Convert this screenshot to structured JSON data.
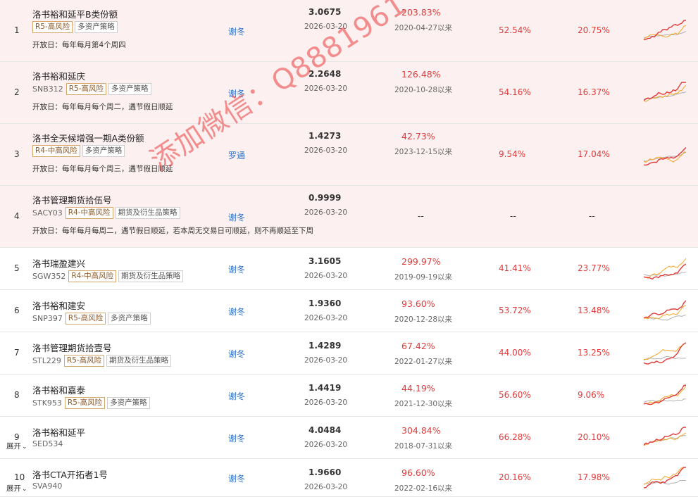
{
  "funds": [
    {
      "rank": "1",
      "name": "洛书裕和延平B类份额",
      "code": "",
      "tags": [
        "R5-高风险",
        "多资产策略"
      ],
      "open": "开放日：每年每月第4个周四",
      "manager": "谢冬",
      "nav": "3.0675",
      "nav_date": "2026-03-20",
      "total_return": "203.83%",
      "since": "2020-04-27以来",
      "ret_a": "52.54%",
      "ret_b": "20.75%"
    },
    {
      "rank": "2",
      "name": "洛书裕和延庆",
      "code": "SNB312",
      "tags": [
        "R5-高风险",
        "多资产策略"
      ],
      "open": "开放日：每年每月每个周二，遇节假日顺延",
      "manager": "谢冬",
      "nav": "2.2648",
      "nav_date": "2026-03-20",
      "total_return": "126.48%",
      "since": "2020-10-28以来",
      "ret_a": "54.16%",
      "ret_b": "16.37%"
    },
    {
      "rank": "3",
      "name": "洛书全天候增强一期A类份额",
      "code": "",
      "tags": [
        "R4-中高风险",
        "多资产策略"
      ],
      "open": "开放日：每年每月每个周三，遇节假日顺延",
      "manager": "罗通",
      "nav": "1.4273",
      "nav_date": "2026-03-20",
      "total_return": "42.73%",
      "since": "2023-12-15以来",
      "ret_a": "9.54%",
      "ret_b": "17.04%"
    },
    {
      "rank": "4",
      "name": "洛书管理期货拾伍号",
      "code": "SACY03",
      "tags": [
        "R4-中高风险",
        "期货及衍生品策略"
      ],
      "open": "开放日：每年每月每周二，遇节假日顺延，若本周无交易日可顺延，则不再顺延至下周",
      "manager": "谢冬",
      "nav": "0.9999",
      "nav_date": "2026-03-20",
      "total_return": "--",
      "since": "",
      "ret_a": "--",
      "ret_b": "--"
    },
    {
      "rank": "5",
      "name": "洛书瑞盈建兴",
      "code": "SGW352",
      "tags": [
        "R4-中高风险",
        "期货及衍生品策略"
      ],
      "open": "",
      "manager": "谢冬",
      "nav": "3.1605",
      "nav_date": "2026-03-20",
      "total_return": "299.97%",
      "since": "2019-09-19以来",
      "ret_a": "41.41%",
      "ret_b": "23.77%"
    },
    {
      "rank": "6",
      "name": "洛书裕和建安",
      "code": "SNP397",
      "tags": [
        "R5-高风险",
        "多资产策略"
      ],
      "open": "",
      "manager": "谢冬",
      "nav": "1.9360",
      "nav_date": "2026-03-20",
      "total_return": "93.60%",
      "since": "2020-12-28以来",
      "ret_a": "53.72%",
      "ret_b": "13.48%"
    },
    {
      "rank": "7",
      "name": "洛书管理期货拾壹号",
      "code": "STL229",
      "tags": [
        "R5-高风险",
        "期货及衍生品策略"
      ],
      "open": "",
      "manager": "谢冬",
      "nav": "1.4289",
      "nav_date": "2026-03-20",
      "total_return": "67.42%",
      "since": "2022-01-27以来",
      "ret_a": "44.00%",
      "ret_b": "13.25%"
    },
    {
      "rank": "8",
      "name": "洛书裕和嘉泰",
      "code": "STK953",
      "tags": [
        "R5-高风险",
        "多资产策略"
      ],
      "open": "",
      "manager": "谢冬",
      "nav": "1.4419",
      "nav_date": "2026-03-20",
      "total_return": "44.19%",
      "since": "2021-12-30以来",
      "ret_a": "56.60%",
      "ret_b": "9.06%"
    },
    {
      "rank": "9",
      "name": "洛书裕和延平",
      "code": "SED534",
      "tags": [],
      "open": "",
      "manager": "谢冬",
      "nav": "4.0484",
      "nav_date": "2026-03-20",
      "total_return": "304.84%",
      "since": "2018-07-31以来",
      "ret_a": "66.28%",
      "ret_b": "20.10%"
    },
    {
      "rank": "10",
      "name": "洛书CTA开拓者1号",
      "code": "SVA940",
      "tags": [],
      "open": "",
      "manager": "谢冬",
      "nav": "1.9660",
      "nav_date": "2026-03-20",
      "total_return": "96.60%",
      "since": "2022-02-16以来",
      "ret_a": "20.16%",
      "ret_b": "17.98%"
    }
  ],
  "expand_label": "展开",
  "expand_icon": "chevron-down-icon",
  "watermark": "添加微信：Q8881961",
  "colors": {
    "positive": "#e23a3a",
    "link": "#2a6fc9",
    "highlight_bg": "#fdf0f0",
    "spark_main": "#e23a3a",
    "spark_alt": "#f5a623",
    "spark_bench": "#b0b0b0"
  }
}
